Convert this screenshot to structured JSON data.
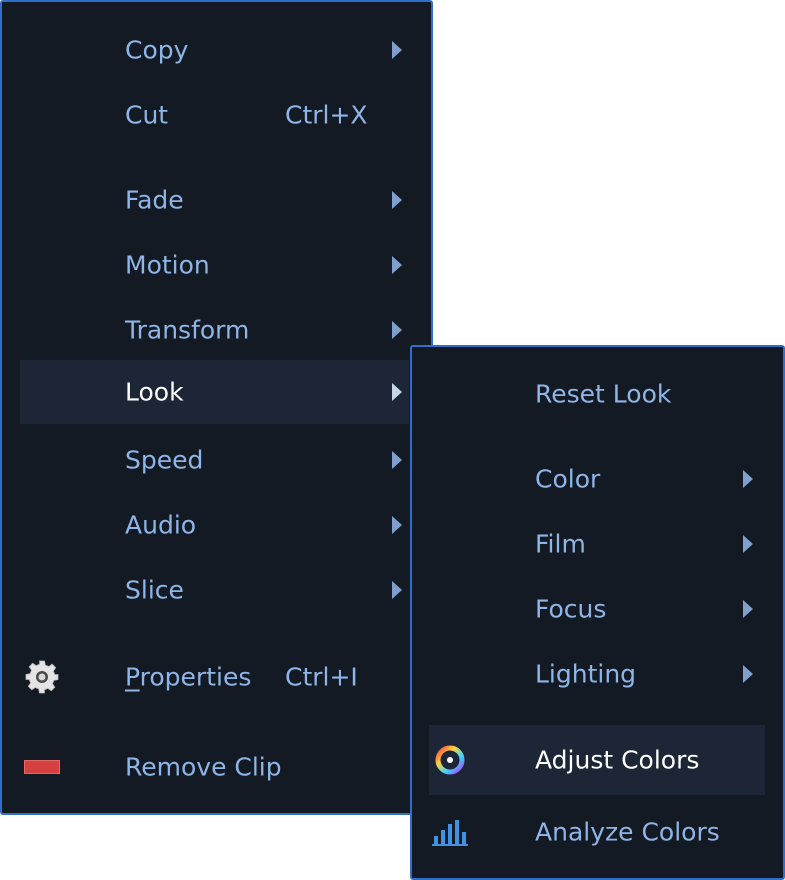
{
  "main_menu": {
    "items": [
      {
        "label": "Copy",
        "shortcut": "",
        "submenu": true
      },
      {
        "label": "Cut",
        "shortcut": "Ctrl+X",
        "submenu": false
      },
      {
        "label": "Fade",
        "shortcut": "",
        "submenu": true
      },
      {
        "label": "Motion",
        "shortcut": "",
        "submenu": true
      },
      {
        "label": "Transform",
        "shortcut": "",
        "submenu": true
      },
      {
        "label": "Look",
        "shortcut": "",
        "submenu": true,
        "highlighted": true
      },
      {
        "label": "Speed",
        "shortcut": "",
        "submenu": true
      },
      {
        "label": "Audio",
        "shortcut": "",
        "submenu": true
      },
      {
        "label": "Slice",
        "shortcut": "",
        "submenu": true
      },
      {
        "label_first": "P",
        "label_rest": "roperties",
        "shortcut": "Ctrl+I",
        "icon": "gear-icon"
      },
      {
        "label": "Remove Clip",
        "shortcut": "",
        "icon": "remove-clip-icon"
      }
    ]
  },
  "sub_menu": {
    "items": [
      {
        "label": "Reset Look"
      },
      {
        "label": "Color",
        "submenu": true
      },
      {
        "label": "Film",
        "submenu": true
      },
      {
        "label": "Focus",
        "submenu": true
      },
      {
        "label": "Lighting",
        "submenu": true
      },
      {
        "label": "Adjust Colors",
        "icon": "color-wheel-icon",
        "highlighted": true
      },
      {
        "label": "Analyze Colors",
        "icon": "bar-chart-icon"
      }
    ]
  },
  "colors": {
    "menu_bg": "#141a24",
    "border": "#2f6fc9",
    "text": "#8fb5e6",
    "highlight_bg": "#1d2636",
    "highlight_text": "#ffffff"
  }
}
